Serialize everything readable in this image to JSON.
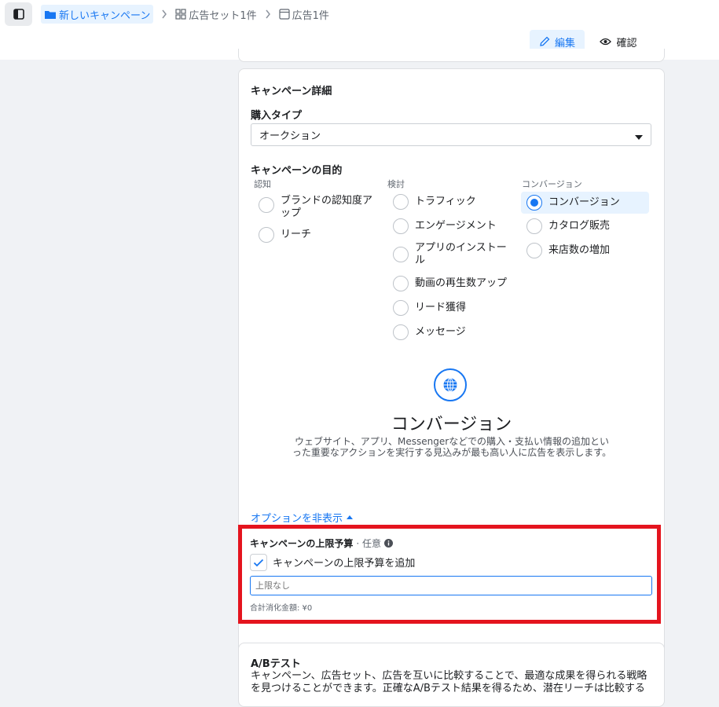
{
  "breadcrumb": {
    "campaign": "新しいキャンペーン",
    "adset": "広告セット1件",
    "ad": "広告1件"
  },
  "toolbar": {
    "edit_label": "編集",
    "review_label": "確認"
  },
  "campaign_details": {
    "title": "キャンペーン詳細",
    "purchase_type_label": "購入タイプ",
    "purchase_type_value": "オークション",
    "objective_label": "キャンペーンの目的",
    "columns": [
      {
        "header": "認知",
        "options": [
          "ブランドの認知度アップ",
          "リーチ"
        ]
      },
      {
        "header": "検討",
        "options": [
          "トラフィック",
          "エンゲージメント",
          "アプリのインストール",
          "動画の再生数アップ",
          "リード獲得",
          "メッセージ"
        ]
      },
      {
        "header": "コンバージョン",
        "options": [
          "コンバージョン",
          "カタログ販売",
          "来店数の増加"
        ]
      }
    ],
    "selected_objective": "コンバージョン",
    "selected_title": "コンバージョン",
    "selected_description": "ウェブサイト、アプリ、Messengerなどでの購入・支払い情報の追加といった重要なアクションを実行する見込みが最も高い人に広告を表示します。",
    "options_toggle": "オプションを非表示"
  },
  "spending_limit": {
    "title": "キャンペーンの上限予算",
    "optional": "· 任意",
    "checkbox_label": "キャンペーンの上限予算を追加",
    "checked": true,
    "input_placeholder": "上限なし",
    "spent_text": "合計消化金額: ¥0"
  },
  "ab_test": {
    "title": "A/Bテスト",
    "description": "キャンペーン、広告セット、広告を互いに比較することで、最適な成果を得られる戦略を見つけることができます。正確なA/Bテスト結果を得るため、潜在リーチは比較する"
  },
  "colors": {
    "accent": "#1877f2",
    "highlight_border": "#e4141e",
    "background": "#f0f2f5"
  }
}
